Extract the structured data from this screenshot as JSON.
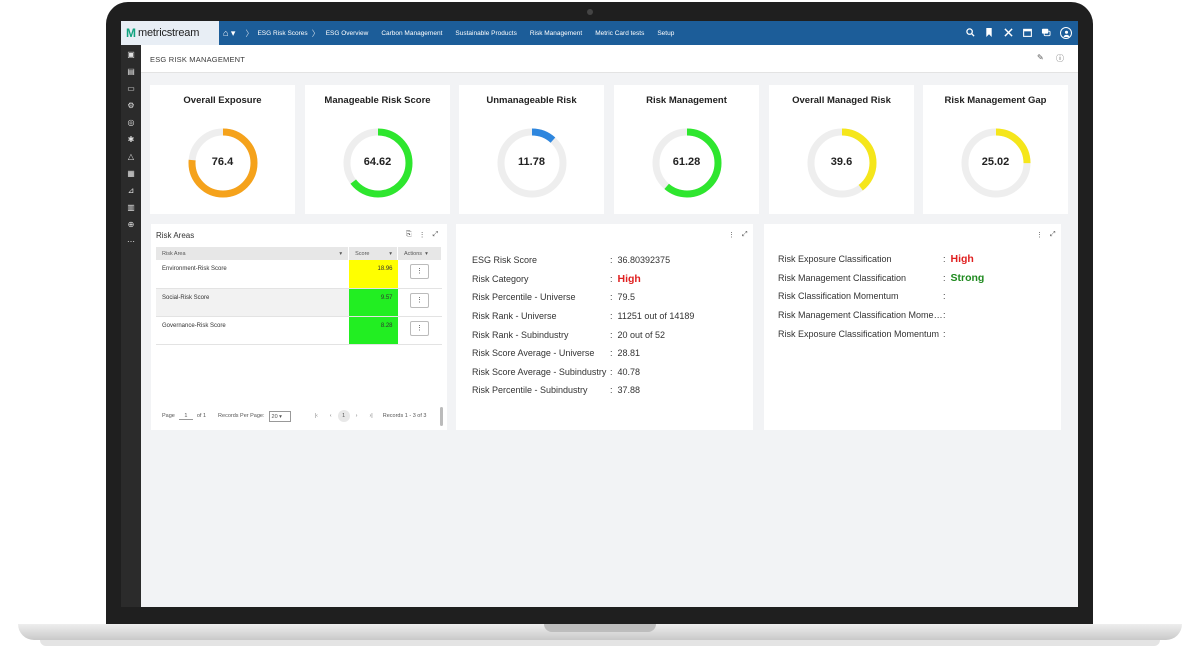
{
  "app": {
    "logo_text": "metricstream"
  },
  "topnav": {
    "items": [
      {
        "label": "ESG Risk Scores"
      },
      {
        "label": "ESG Overview"
      },
      {
        "label": "Carbon Management"
      },
      {
        "label": "Sustainable Products"
      },
      {
        "label": "Risk Management"
      },
      {
        "label": "Metric Card tests"
      },
      {
        "label": "Setup"
      }
    ]
  },
  "page": {
    "title": "ESG RISK MANAGEMENT"
  },
  "cards": [
    {
      "title": "Overall Exposure",
      "value": "76.4",
      "percent": 76.4,
      "color": "#f5a21b"
    },
    {
      "title": "Manageable Risk Score",
      "value": "64.62",
      "percent": 64.62,
      "color": "#2ee62e"
    },
    {
      "title": "Unmanageable Risk",
      "value": "11.78",
      "percent": 11.78,
      "color": "#2e86de"
    },
    {
      "title": "Risk Management",
      "value": "61.28",
      "percent": 61.28,
      "color": "#2ee62e"
    },
    {
      "title": "Overall Managed Risk",
      "value": "39.6",
      "percent": 39.6,
      "color": "#f5e61b"
    },
    {
      "title": "Risk Management Gap",
      "value": "25.02",
      "percent": 25.02,
      "color": "#f5e61b"
    }
  ],
  "risk_areas": {
    "title": "Risk Areas",
    "columns": {
      "area": "Risk Area",
      "score": "Score",
      "actions": "Actions"
    },
    "rows": [
      {
        "area": "Environment-Risk Score",
        "score": "18.96",
        "color": "#ffff00"
      },
      {
        "area": "Social-Risk Score",
        "score": "9.57",
        "color": "#22ee22"
      },
      {
        "area": "Governance-Risk Score",
        "score": "8.28",
        "color": "#22ee22"
      }
    ],
    "pager": {
      "page_label": "Page",
      "page_value": "1",
      "of_label": "of 1",
      "records_label": "Records Per Page:",
      "records_value": "20",
      "current_page": "1",
      "summary": "Records 1 - 3 of 3"
    }
  },
  "details": [
    {
      "label": "ESG Risk Score",
      "value": "36.80392375"
    },
    {
      "label": "Risk Category",
      "value": "High",
      "style": "red"
    },
    {
      "label": "Risk Percentile - Universe",
      "value": "79.5"
    },
    {
      "label": "Risk Rank - Universe",
      "value": "11251 out of 14189"
    },
    {
      "label": "Risk Rank - Subindustry",
      "value": "20 out of 52"
    },
    {
      "label": "Risk Score Average - Universe",
      "value": "28.81"
    },
    {
      "label": "Risk Score Average - Subindustry",
      "value": "40.78"
    },
    {
      "label": "Risk Percentile - Subindustry",
      "value": "37.88"
    }
  ],
  "classification": [
    {
      "label": "Risk Exposure Classification",
      "value": "High",
      "style": "red"
    },
    {
      "label": "Risk Management Classification",
      "value": "Strong",
      "style": "green"
    },
    {
      "label": "Risk Classification Momentum",
      "value": ""
    },
    {
      "label": "Risk Management Classification Momentum",
      "value": ""
    },
    {
      "label": "Risk Exposure Classification Momentum",
      "value": ""
    }
  ],
  "icons": {
    "home": "home-icon",
    "search": "search-icon",
    "bookmark": "bookmark-icon",
    "tools": "tools-icon",
    "calendar": "calendar-icon",
    "chat": "chat-icon",
    "user": "user-icon"
  }
}
